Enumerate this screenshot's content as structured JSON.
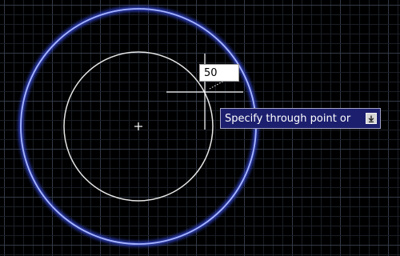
{
  "drawing": {
    "background_color": "#000000",
    "minor_grid_color": "#1a1f26",
    "major_grid_color": "#333b47",
    "inner_circle_color": "#e6e6e6",
    "offset_circle_color": "#a9b6ff",
    "offset_glow_color": "#3448d6",
    "crosshair_color": "#ffffff",
    "center_marker_icon": "plus-icon",
    "cursor_icon": "crosshair-icon"
  },
  "dynamic_input": {
    "value": "50"
  },
  "tooltip": {
    "text": "Specify through point or",
    "options_icon": "down-arrow-icon",
    "background_color": "#1c1f6e"
  }
}
